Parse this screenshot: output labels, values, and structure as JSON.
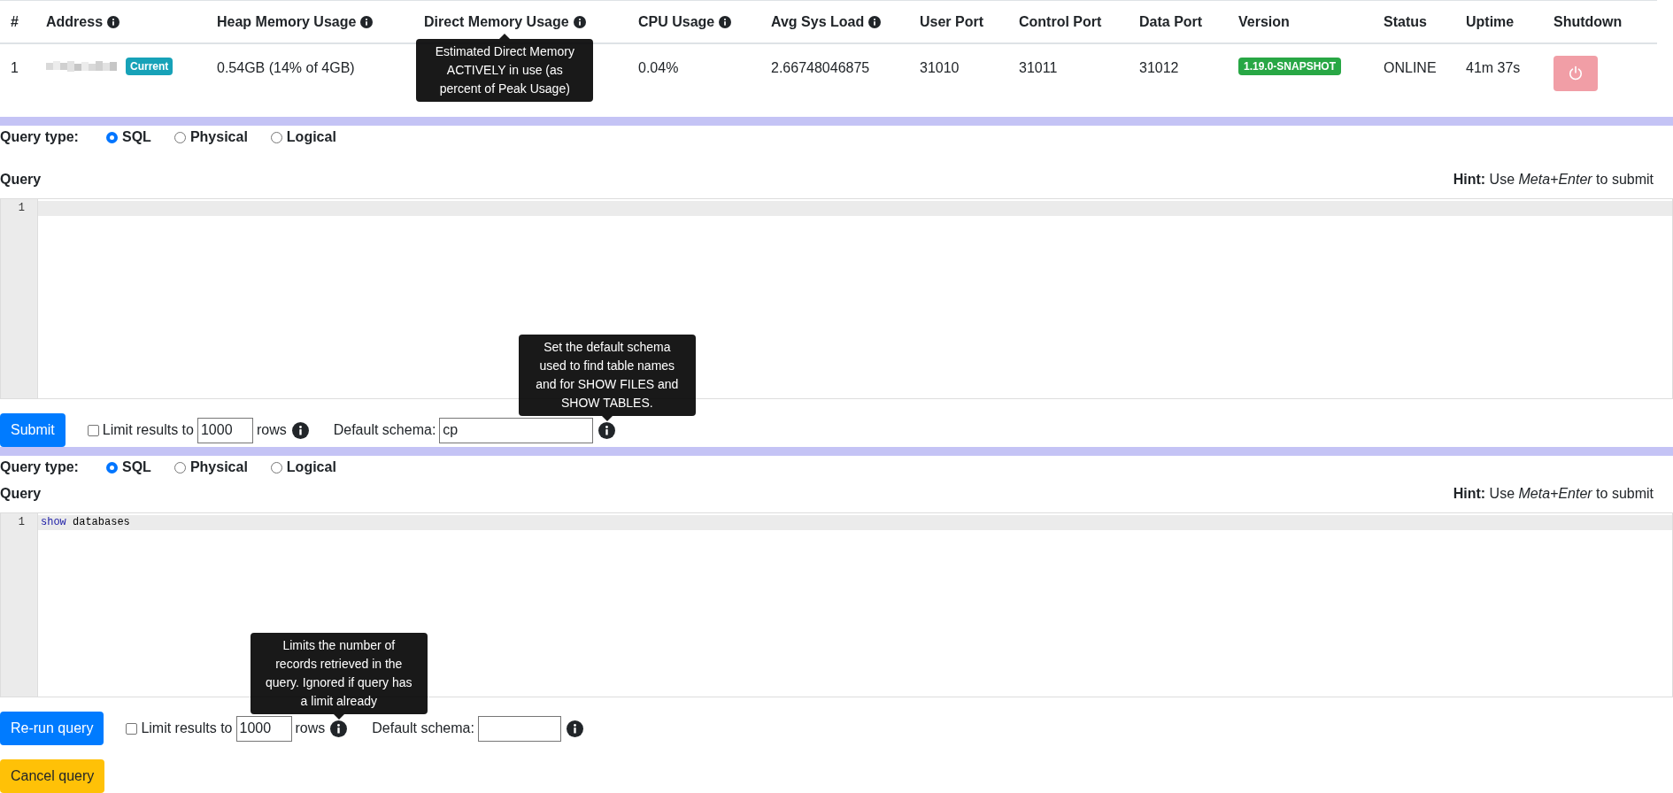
{
  "cluster_table": {
    "columns": [
      {
        "label": "#",
        "info": false
      },
      {
        "label": "Address",
        "info": true
      },
      {
        "label": "Heap Memory Usage",
        "info": true
      },
      {
        "label": "Direct Memory Usage",
        "info": true,
        "tooltip": "Estimated Direct Memory ACTIVELY in use (as percent of Peak Usage)"
      },
      {
        "label": "CPU Usage",
        "info": true
      },
      {
        "label": "Avg Sys Load",
        "info": true
      },
      {
        "label": "User Port",
        "info": false
      },
      {
        "label": "Control Port",
        "info": false
      },
      {
        "label": "Data Port",
        "info": false
      },
      {
        "label": "Version",
        "info": false
      },
      {
        "label": "Status",
        "info": false
      },
      {
        "label": "Uptime",
        "info": false
      },
      {
        "label": "Shutdown",
        "info": false
      }
    ],
    "rows": [
      {
        "cells": [
          {
            "kind": "text",
            "text": "1"
          },
          {
            "kind": "address",
            "badge": "Current"
          },
          {
            "kind": "text",
            "text": "0.54GB (14% of 4GB)"
          },
          {
            "kind": "covered"
          },
          {
            "kind": "text",
            "text": "0.04%"
          },
          {
            "kind": "text",
            "text": "2.66748046875"
          },
          {
            "kind": "text",
            "text": "31010"
          },
          {
            "kind": "text",
            "text": "31011"
          },
          {
            "kind": "text",
            "text": "31012"
          },
          {
            "kind": "badge",
            "text": "1.19.0-SNAPSHOT"
          },
          {
            "kind": "text",
            "text": "ONLINE"
          },
          {
            "kind": "text",
            "text": "41m 37s"
          },
          {
            "kind": "shutdown",
            "disabled": true
          }
        ]
      }
    ]
  },
  "query_panels": [
    {
      "query_type_label": "Query type:",
      "options": [
        {
          "label": "SQL",
          "selected": true
        },
        {
          "label": "Physical",
          "selected": false
        },
        {
          "label": "Logical",
          "selected": false
        }
      ],
      "query_label": "Query",
      "hint": "**Hint:** Use *Meta+Enter* to submit",
      "lines": [
        {
          "number": "1"
        }
      ],
      "buttons": [
        {
          "kind": "primary",
          "label": "Submit"
        }
      ],
      "limit": {
        "checked": false,
        "label": "Limit results to",
        "value": "1000",
        "suffix": "rows"
      },
      "schema": {
        "label": "Default schema:",
        "value": "cp",
        "tooltip": "Set the default schema used to find table names and for SHOW FILES and SHOW TABLES."
      }
    },
    {
      "query_type_label": "Query type:",
      "options": [
        {
          "label": "SQL",
          "selected": true
        },
        {
          "label": "Physical",
          "selected": false
        },
        {
          "label": "Logical",
          "selected": false
        }
      ],
      "query_label": "Query",
      "hint": "**Hint:** Use *Meta+Enter* to submit",
      "lines": [
        {
          "number": "1",
          "tokens": [
            {
              "kind": "keyword",
              "text": "show"
            },
            {
              "kind": "plain",
              "text": " databases"
            }
          ]
        }
      ],
      "buttons": [
        {
          "kind": "primary",
          "label": "Re-run query"
        },
        {
          "kind": "warning",
          "label": "Cancel query"
        }
      ],
      "limit": {
        "checked": false,
        "label": "Limit results to",
        "value": "1000",
        "suffix": "rows",
        "tooltip": "Limits the number of records retrieved in the query. Ignored if query has a limit already"
      },
      "schema": {
        "label": "Default schema:"
      }
    }
  ]
}
